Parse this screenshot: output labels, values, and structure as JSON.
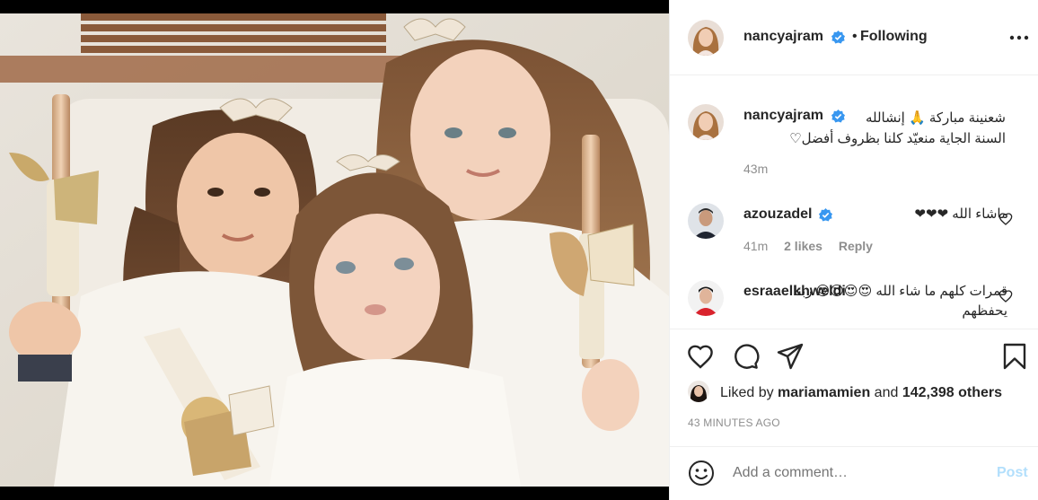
{
  "post": {
    "username": "nancyajram",
    "separator": "•",
    "follow_status": "Following",
    "caption": {
      "username": "nancyajram",
      "text": "شعنينة مباركة 🙏 إنشالله\nالسنة الجاية منعيّد كلنا بظروف أفضل♡",
      "time": "43m"
    },
    "comments": [
      {
        "username": "azouzadel",
        "verified": true,
        "text": "ماشاء الله ❤❤❤",
        "time": "41m",
        "likes": "2 likes",
        "reply": "Reply"
      },
      {
        "username": "esraaelkhweldi",
        "verified": false,
        "text": "قمرات كلهم ما شاء الله 😍😍😍😍 ربنا يحفظهم"
      }
    ],
    "liked_by_prefix": "Liked by ",
    "liked_by_user": "mariamamien",
    "liked_by_and": " and ",
    "liked_by_others": "142,398 others",
    "posted_ago": "43 MINUTES AGO",
    "comment_placeholder": "Add a comment…",
    "post_label": "Post"
  },
  "colors": {
    "verified": "#3897f0",
    "heart": "#ed4956",
    "post_disabled": "#b2dffc",
    "muted": "#8e8e8e"
  },
  "icons": [
    "more-options-icon",
    "verified-icon",
    "heart-icon",
    "comment-icon",
    "share-icon",
    "bookmark-icon",
    "emoji-icon"
  ]
}
